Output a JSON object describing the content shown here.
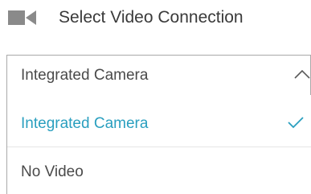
{
  "header": {
    "icon": "video-camera-icon",
    "title": "Select Video Connection"
  },
  "select": {
    "value": "Integrated Camera",
    "expanded": true,
    "icon": "chevron-up-icon"
  },
  "options": [
    {
      "label": "Integrated Camera",
      "selected": true,
      "icon": "check-icon"
    },
    {
      "label": "No Video",
      "selected": false
    }
  ],
  "colors": {
    "accent": "#2a9fbf",
    "text": "#4a4a4a",
    "icon": "#8a8a8a",
    "border": "#a9a9a9"
  }
}
